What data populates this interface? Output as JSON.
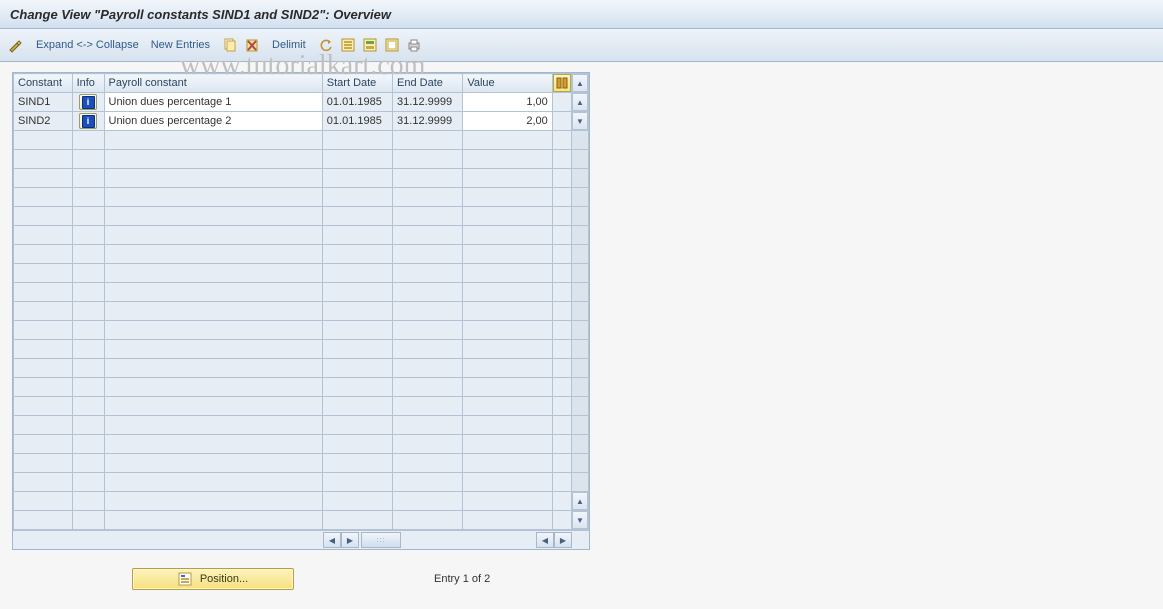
{
  "title": "Change View \"Payroll constants SIND1 and SIND2\": Overview",
  "watermark": "www.tutorialkart.com",
  "toolbar": {
    "expand_collapse": "Expand <-> Collapse",
    "new_entries": "New Entries",
    "delimit": "Delimit"
  },
  "columns": {
    "constant": "Constant",
    "info": "Info",
    "payroll_constant": "Payroll constant",
    "start": "Start Date",
    "end": "End Date",
    "value": "Value"
  },
  "rows": [
    {
      "constant": "SIND1",
      "desc": "Union dues percentage 1",
      "start": "01.01.1985",
      "end": "31.12.9999",
      "value": "1,00"
    },
    {
      "constant": "SIND2",
      "desc": "Union dues percentage 2",
      "start": "01.01.1985",
      "end": "31.12.9999",
      "value": "2,00"
    }
  ],
  "empty_row_count": 21,
  "footer": {
    "position_label": "Position...",
    "entry_text": "Entry 1 of 2"
  }
}
